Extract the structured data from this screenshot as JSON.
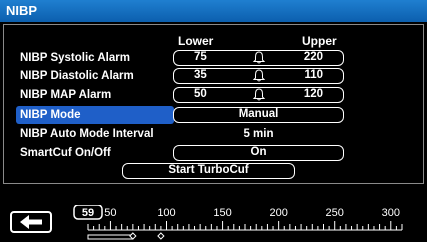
{
  "title": "NIBP",
  "columns": {
    "lower": "Lower",
    "upper": "Upper"
  },
  "rows": {
    "systolic": {
      "label": "NIBP Systolic Alarm",
      "lower": "75",
      "upper": "220"
    },
    "diastolic": {
      "label": "NIBP Diastolic Alarm",
      "lower": "35",
      "upper": "110"
    },
    "map": {
      "label": "NIBP MAP Alarm",
      "lower": "50",
      "upper": "120"
    },
    "mode": {
      "label": "NIBP Mode",
      "value": "Manual"
    },
    "interval": {
      "label": "NIBP Auto Mode Interval",
      "value": "5 min"
    },
    "smartcuf": {
      "label": "SmartCuf On/Off",
      "value": "On"
    }
  },
  "turbocuf_button": "Start TurboCuf",
  "scale": {
    "current_value": "59",
    "tick_labels": [
      "50",
      "100",
      "150",
      "200",
      "250",
      "300"
    ],
    "min": 30,
    "max": 310,
    "markers": [
      70,
      95
    ],
    "range_bar": [
      30,
      70
    ]
  },
  "colors": {
    "title": "#1a74c8",
    "selected": "#1f5fc8"
  },
  "icons": {
    "alarm": "bell-icon",
    "back": "back-arrow-icon"
  }
}
